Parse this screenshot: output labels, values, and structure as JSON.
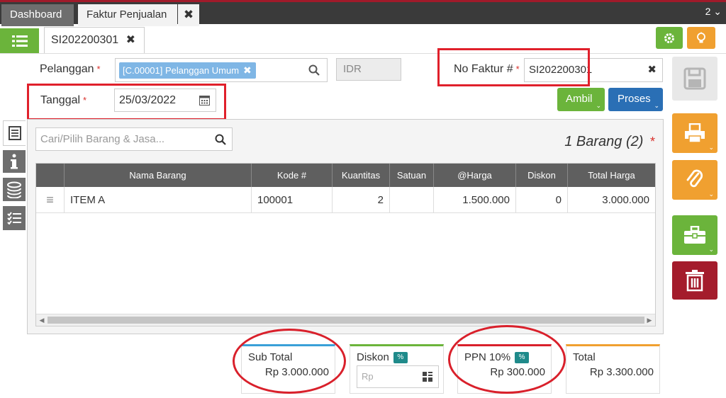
{
  "app_tabs": {
    "dashboard": "Dashboard",
    "faktur": "Faktur Penjualan",
    "close": "✖",
    "count": "2",
    "count_caret": "⌄"
  },
  "doc_tab": {
    "label": "SI202200301",
    "close": "✖"
  },
  "form": {
    "pelanggan_label": "Pelanggan",
    "pelanggan_value": "[C.00001] Pelanggan Umum",
    "chip_remove": "✖",
    "currency": "IDR",
    "nofaktur_label": "No Faktur #",
    "nofaktur_value": "SI202200301",
    "nofaktur_clear": "✖",
    "tanggal_label": "Tanggal",
    "tanggal_value": "25/03/2022",
    "required_mark": "*"
  },
  "buttons": {
    "ambil": "Ambil",
    "proses": "Proses",
    "caret": "⌄"
  },
  "items": {
    "search_placeholder": "Cari/Pilih Barang & Jasa...",
    "count_text": "1 Barang (2)",
    "columns": [
      "Nama Barang",
      "Kode #",
      "Kuantitas",
      "Satuan",
      "@Harga",
      "Diskon",
      "Total Harga"
    ],
    "rows": [
      {
        "handle": "≡",
        "name": "ITEM A",
        "kode": "100001",
        "qty": "2",
        "satuan": "",
        "harga": "1.500.000",
        "diskon": "0",
        "total": "3.000.000"
      }
    ],
    "scroll_left": "◀",
    "scroll_right": "▶"
  },
  "summary": {
    "subtotal_label": "Sub Total",
    "subtotal_value": "Rp 3.000.000",
    "diskon_label": "Diskon",
    "diskon_pct": "%",
    "diskon_placeholder": "Rp",
    "ppn_label": "PPN 10%",
    "ppn_pct": "%",
    "ppn_value": "Rp 300.000",
    "total_label": "Total",
    "total_value": "Rp 3.300.000"
  },
  "colors": {
    "green": "#6bb43b",
    "orange": "#f0a030",
    "blue": "#2a6fb5",
    "red": "#a41c2c",
    "annotation": "#e0202b"
  }
}
